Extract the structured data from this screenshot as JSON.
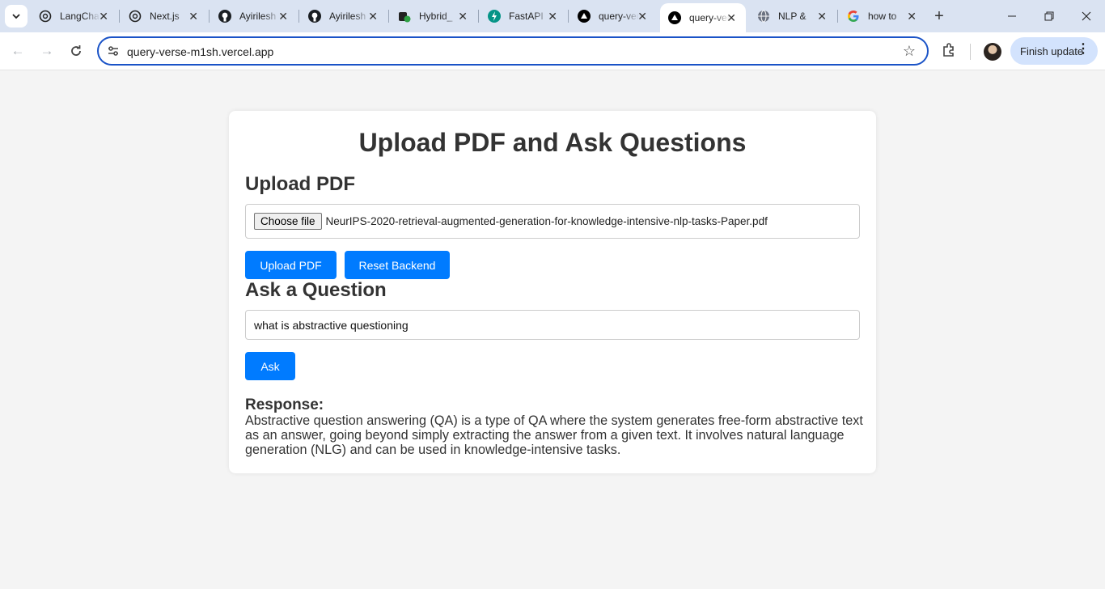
{
  "browser": {
    "tabs": [
      {
        "title": "LangChain",
        "favicon": "openai-icon"
      },
      {
        "title": "Next.js",
        "favicon": "openai-icon"
      },
      {
        "title": "Ayirilesh",
        "favicon": "github-icon"
      },
      {
        "title": "Ayirilesh",
        "favicon": "github-icon"
      },
      {
        "title": "Hybrid_",
        "favicon": "hybrid-icon"
      },
      {
        "title": "FastAPI",
        "favicon": "fastapi-icon"
      },
      {
        "title": "query-verse",
        "favicon": "vercel-icon"
      },
      {
        "title": "query-verse",
        "favicon": "vercel-icon",
        "active": true
      },
      {
        "title": "NLP &",
        "favicon": "globe-icon"
      },
      {
        "title": "how to",
        "favicon": "google-icon"
      }
    ],
    "url": "query-verse-m1sh.vercel.app",
    "update_button": "Finish update"
  },
  "page": {
    "title": "Upload PDF and Ask Questions",
    "upload_heading": "Upload PDF",
    "choose_file_label": "Choose file",
    "selected_file": "NeurIPS-2020-retrieval-augmented-generation-for-knowledge-intensive-nlp-tasks-Paper.pdf",
    "upload_button": "Upload PDF",
    "reset_button": "Reset Backend",
    "ask_heading": "Ask a Question",
    "question_value": "what is abstractive questioning",
    "ask_button": "Ask",
    "response_label": "Response:",
    "response_text": "Abstractive question answering (QA) is a type of QA where the system generates free-form abstractive text as an answer, going beyond simply extracting the answer from a given text. It involves natural language generation (NLG) and can be used in knowledge-intensive tasks."
  },
  "colors": {
    "primary_button": "#007bff",
    "omnibox_border": "#1a53c7",
    "tabbar": "#dae3f2",
    "page_background": "#f4f4f4"
  }
}
